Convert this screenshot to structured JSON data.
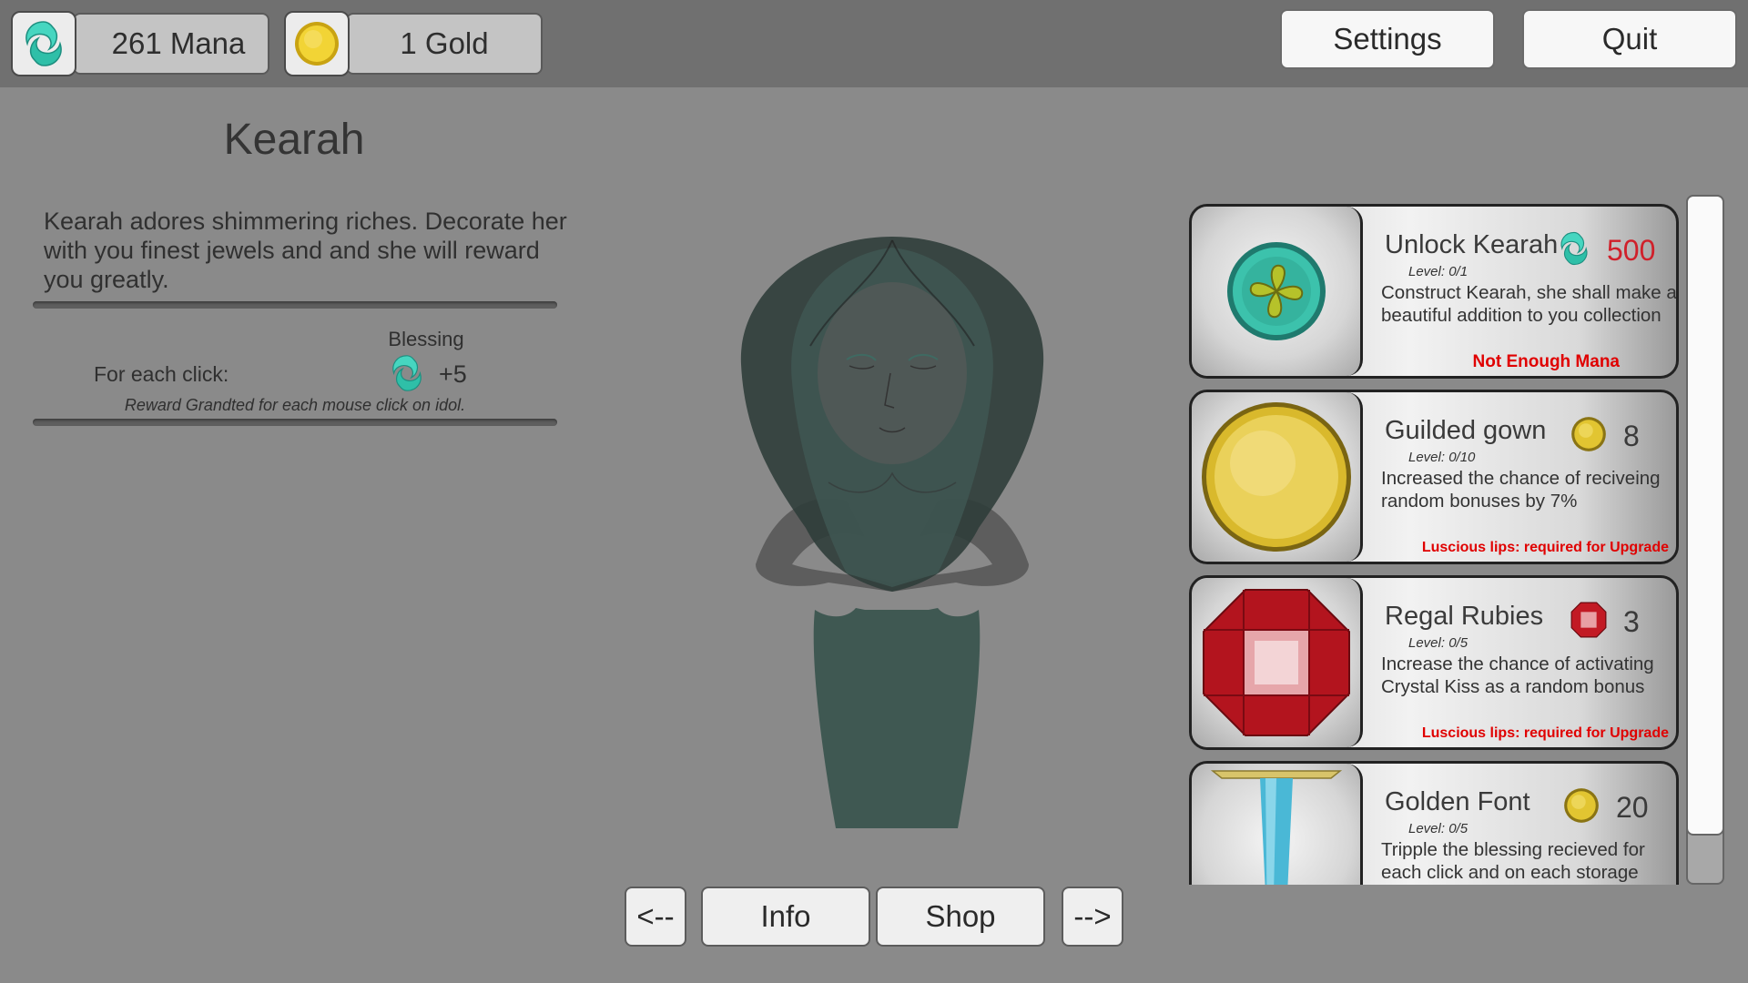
{
  "resources": {
    "mana": {
      "label": "261 Mana",
      "icon": "mana-swirl-icon"
    },
    "gold": {
      "label": "1 Gold",
      "icon": "gold-coin-icon"
    }
  },
  "top_buttons": {
    "settings": "Settings",
    "quit": "Quit"
  },
  "character": {
    "name": "Kearah",
    "description": "Kearah adores shimmering riches.\nDecorate her with you finest jewels and and she will reward you greatly.",
    "blessing_label": "Blessing",
    "click_label": "For each click:",
    "click_value": "+5",
    "reward_note": "Reward Grandted for each mouse click on idol."
  },
  "nav": {
    "prev": "<--",
    "info": "Info",
    "shop": "Shop",
    "next": "-->"
  },
  "shop_items": [
    {
      "title": "Unlock Kearah",
      "cost": "500",
      "cost_icon": "mana-swirl-icon",
      "cost_color": "#d0202a",
      "level": "Level: 0/1",
      "description": "Construct Kearah, she shall make a beautiful addition to you collection",
      "warning": "Not Enough Mana",
      "image": "clover-medallion-icon"
    },
    {
      "title": "Guilded gown",
      "cost": "8",
      "cost_icon": "gold-coin-icon",
      "level": "Level: 0/10",
      "description": "Increased the chance of reciveing random bonuses by 7%",
      "warning": "Luscious  lips: required for Upgrade",
      "image": "gold-coin-icon"
    },
    {
      "title": "Regal Rubies",
      "cost": "3",
      "cost_icon": "ruby-icon",
      "level": "Level: 0/5",
      "description": "Increase the chance of activating Crystal Kiss as a random bonus",
      "warning": "Luscious  lips: required for Upgrade",
      "image": "ruby-icon"
    },
    {
      "title": "Golden Font",
      "cost": "20",
      "cost_icon": "gold-coin-icon",
      "level": "Level: 0/5",
      "description": "Tripple the blessing recieved for each click and on each storage",
      "warning": "",
      "image": "font-pedestal-icon"
    }
  ],
  "colors": {
    "background": "#8a8a8a",
    "topbar": "#707070",
    "mana": "#3cc8b4",
    "gold": "#e6c21e",
    "ruby": "#d4232d",
    "warning": "#e00000",
    "idol": "#3c5a52"
  }
}
